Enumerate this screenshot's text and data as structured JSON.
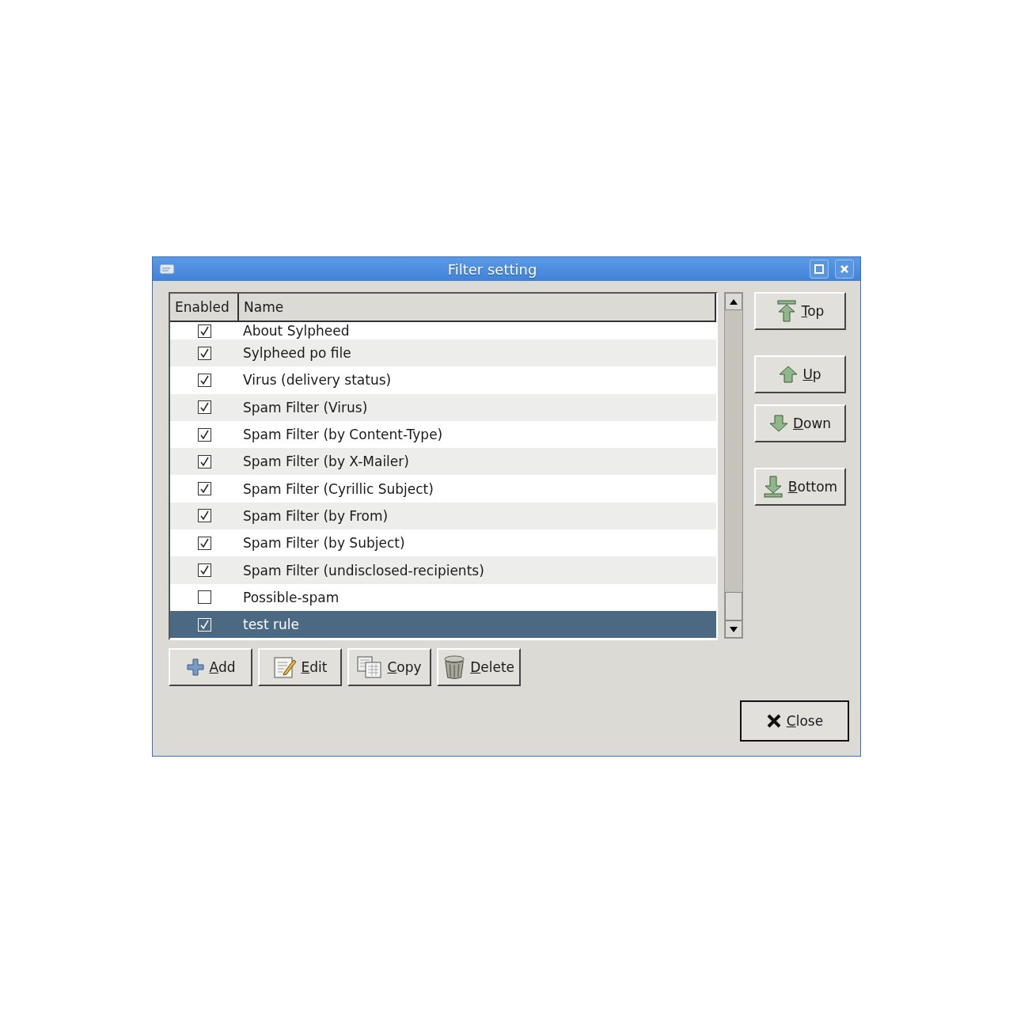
{
  "window": {
    "title": "Filter setting"
  },
  "columns": [
    "Enabled",
    "Name"
  ],
  "rows": [
    {
      "name": "About Sylpheed",
      "enabled": true,
      "selected": false,
      "kind": "partial"
    },
    {
      "name": "Sylpheed po file",
      "enabled": true,
      "selected": false
    },
    {
      "name": "Virus (delivery status)",
      "enabled": true,
      "selected": false
    },
    {
      "name": "Spam Filter (Virus)",
      "enabled": true,
      "selected": false
    },
    {
      "name": "Spam Filter (by Content-Type)",
      "enabled": true,
      "selected": false
    },
    {
      "name": "Spam Filter (by X-Mailer)",
      "enabled": true,
      "selected": false
    },
    {
      "name": "Spam Filter (Cyrillic Subject)",
      "enabled": true,
      "selected": false
    },
    {
      "name": "Spam Filter (by From)",
      "enabled": true,
      "selected": false
    },
    {
      "name": "Spam Filter (by Subject)",
      "enabled": true,
      "selected": false
    },
    {
      "name": "Spam Filter (undisclosed-recipients)",
      "enabled": true,
      "selected": false
    },
    {
      "name": "Possible-spam",
      "enabled": false,
      "selected": false
    },
    {
      "name": "test rule",
      "enabled": true,
      "selected": true
    }
  ],
  "move_buttons": [
    {
      "label": "Top",
      "kind": "top"
    },
    {
      "label": "Up",
      "kind": "up"
    },
    {
      "label": "Down",
      "kind": "down"
    },
    {
      "label": "Bottom",
      "kind": "bottom"
    }
  ],
  "action_buttons": [
    {
      "label": "Add",
      "kind": "add"
    },
    {
      "label": "Edit",
      "kind": "edit"
    },
    {
      "label": "Copy",
      "kind": "copy"
    },
    {
      "label": "Delete",
      "kind": "delete"
    }
  ],
  "close_button": {
    "label": "Close"
  }
}
